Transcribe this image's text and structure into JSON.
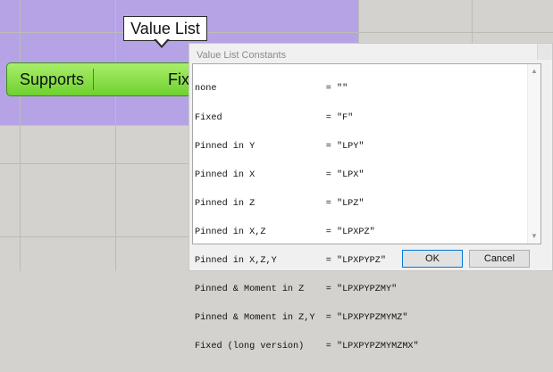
{
  "tooltip": {
    "text": "Value List"
  },
  "component": {
    "label": "Supports",
    "value": "Fix"
  },
  "dialog": {
    "title": "Value List Constants",
    "lines": [
      "none                    = \"\"",
      "Fixed                   = \"F\"",
      "Pinned in Y             = \"LPY\"",
      "Pinned in X             = \"LPX\"",
      "Pinned in Z             = \"LPZ\"",
      "Pinned in X,Z           = \"LPXPZ\"",
      "Pinned in X,Z,Y         = \"LPXPYPZ\"",
      "Pinned & Moment in Z    = \"LPXPYPZMY\"",
      "Pinned & Moment in Z,Y  = \"LPXPYPZMYMZ\"",
      "Fixed (long version)    = \"LPXPYPZMYMZMX\""
    ],
    "ok_label": "OK",
    "cancel_label": "Cancel"
  },
  "icons": {
    "scroll_up": "scroll-up-icon",
    "scroll_down": "scroll-down-icon",
    "close": "close-icon"
  },
  "colors": {
    "group": "#b6a3e6",
    "component": "#6fd12f",
    "canvas": "#d4d2cf"
  }
}
